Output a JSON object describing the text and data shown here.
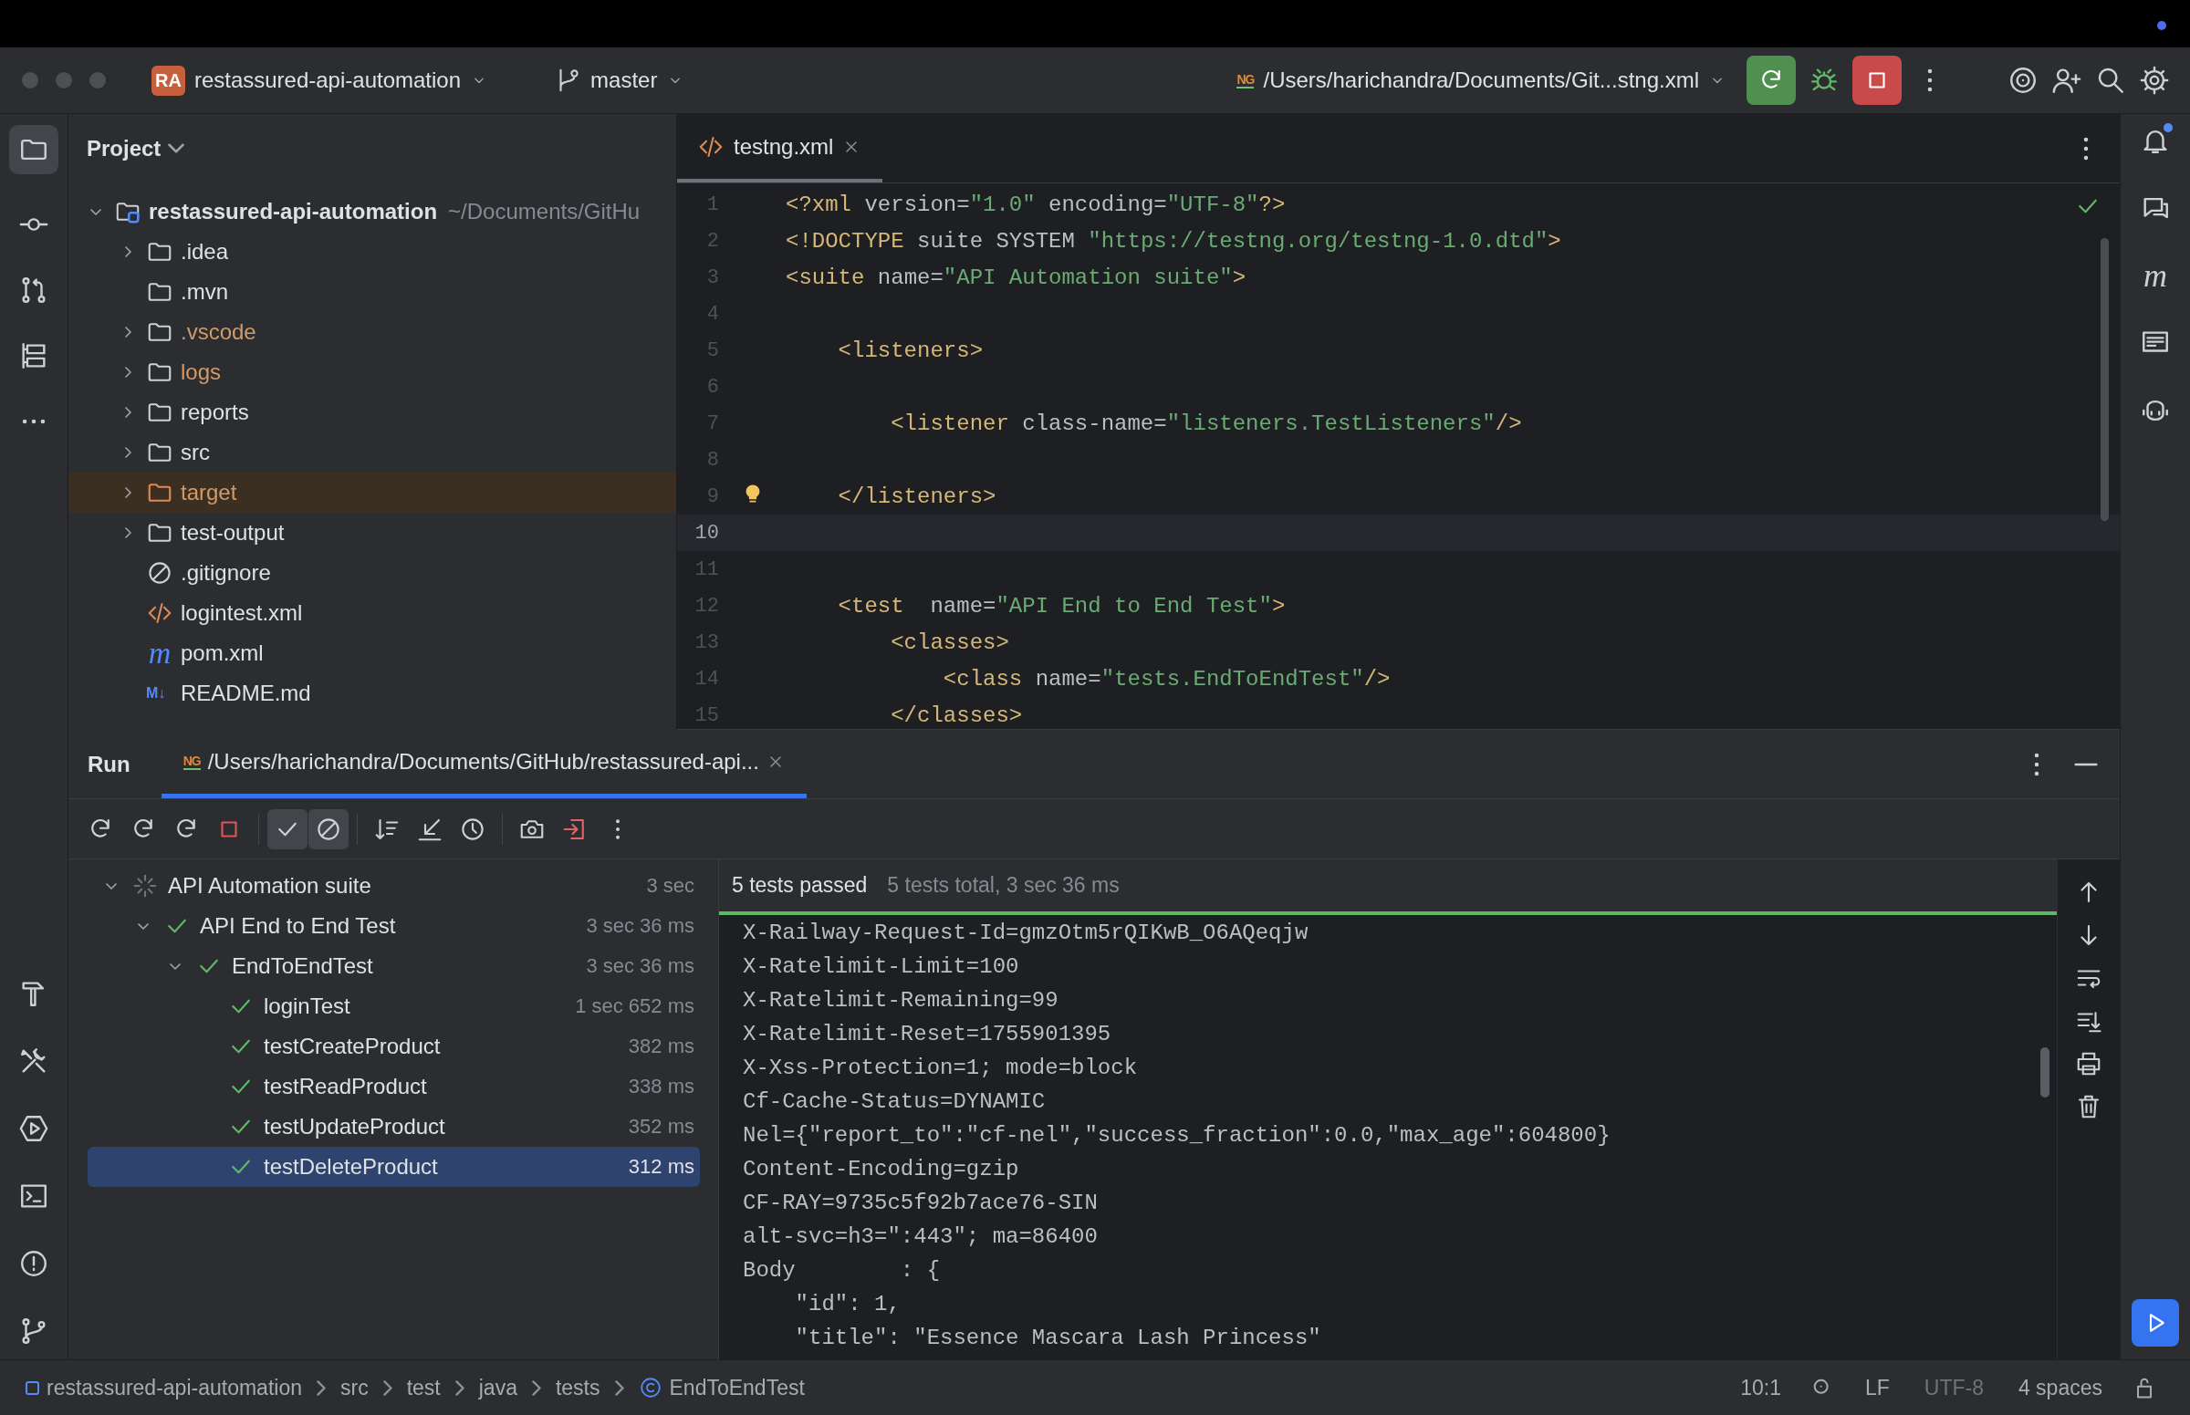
{
  "title_bar": {
    "project_badge": "RA",
    "project": "restassured-api-automation",
    "branch": "master",
    "run_config_badge": "NG",
    "run_config": "/Users/harichandra/Documents/Git...stng.xml"
  },
  "project_panel": {
    "title": "Project",
    "tree": [
      {
        "name": "restassured-api-automation",
        "path": "~/Documents/GitHu",
        "kind": "module",
        "expanded": true,
        "selected": false,
        "ignored": false,
        "children": [
          {
            "name": ".idea",
            "kind": "folder",
            "expanded": false,
            "selected": false,
            "ignored": false
          },
          {
            "name": ".mvn",
            "kind": "folder",
            "selected": false,
            "ignored": false
          },
          {
            "name": ".vscode",
            "kind": "folder",
            "expanded": false,
            "selected": false,
            "ignored": true
          },
          {
            "name": "logs",
            "kind": "folder",
            "expanded": false,
            "selected": false,
            "ignored": true
          },
          {
            "name": "reports",
            "kind": "folder",
            "expanded": false,
            "selected": false,
            "ignored": false
          },
          {
            "name": "src",
            "kind": "folder",
            "expanded": false,
            "selected": false,
            "ignored": false
          },
          {
            "name": "target",
            "kind": "excluded",
            "expanded": false,
            "selected": true,
            "ignored": true
          },
          {
            "name": "test-output",
            "kind": "folder",
            "expanded": false,
            "selected": false,
            "ignored": false
          },
          {
            "name": ".gitignore",
            "kind": "gitignore",
            "selected": false,
            "ignored": false
          },
          {
            "name": "logintest.xml",
            "kind": "xml",
            "selected": false,
            "ignored": false
          },
          {
            "name": "pom.xml",
            "kind": "maven",
            "glyph": "m",
            "selected": false,
            "ignored": false
          },
          {
            "name": "README.md",
            "kind": "markdown",
            "glyph": "M↓",
            "selected": false,
            "ignored": false
          }
        ]
      }
    ]
  },
  "editor": {
    "tabs": [
      {
        "label": "testng.xml",
        "selected": true
      }
    ],
    "inspection_ok": true,
    "right_strip_glyph": "m",
    "lines": [
      {
        "number": "1",
        "current": false,
        "bulb": false,
        "tokens": [
          {
            "kind": "tag",
            "text": "<?xml"
          },
          {
            "kind": "attr",
            "text": " version="
          },
          {
            "kind": "string",
            "text": "\"1.0\""
          },
          {
            "kind": "attr",
            "text": " encoding="
          },
          {
            "kind": "string",
            "text": "\"UTF-8\""
          },
          {
            "kind": "tag",
            "text": "?>"
          }
        ]
      },
      {
        "number": "2",
        "current": false,
        "bulb": false,
        "tokens": [
          {
            "kind": "tag",
            "text": "<!DOCTYPE"
          },
          {
            "kind": "plain",
            "text": " suite SYSTEM "
          },
          {
            "kind": "string",
            "text": "\"https://testng.org/testng-1.0.dtd\""
          },
          {
            "kind": "tag",
            "text": ">"
          }
        ]
      },
      {
        "number": "3",
        "current": false,
        "bulb": false,
        "tokens": [
          {
            "kind": "tag",
            "text": "<suite"
          },
          {
            "kind": "attr",
            "text": " name="
          },
          {
            "kind": "string",
            "text": "\"API Automation suite\""
          },
          {
            "kind": "tag",
            "text": ">"
          }
        ]
      },
      {
        "number": "4",
        "current": false,
        "bulb": false
      },
      {
        "number": "5",
        "current": false,
        "bulb": false,
        "tokens": [
          {
            "kind": "tag",
            "text": "    <listeners>"
          }
        ]
      },
      {
        "number": "6",
        "current": false,
        "bulb": false
      },
      {
        "number": "7",
        "current": false,
        "bulb": false,
        "tokens": [
          {
            "kind": "tag",
            "text": "        <listener"
          },
          {
            "kind": "attr",
            "text": " class-name="
          },
          {
            "kind": "string",
            "text": "\"listeners.TestListeners\""
          },
          {
            "kind": "tag",
            "text": "/>"
          }
        ]
      },
      {
        "number": "8",
        "current": false,
        "bulb": false
      },
      {
        "number": "9",
        "current": false,
        "bulb": true,
        "tokens": [
          {
            "kind": "tag",
            "text": "    </listeners>"
          }
        ]
      },
      {
        "number": "10",
        "current": true,
        "bulb": false
      },
      {
        "number": "11",
        "current": false,
        "bulb": false
      },
      {
        "number": "12",
        "current": false,
        "bulb": false,
        "tokens": [
          {
            "kind": "tag",
            "text": "    <test"
          },
          {
            "kind": "attr",
            "text": "  name="
          },
          {
            "kind": "string",
            "text": "\"API End to End Test\""
          },
          {
            "kind": "tag",
            "text": ">"
          }
        ]
      },
      {
        "number": "13",
        "current": false,
        "bulb": false,
        "tokens": [
          {
            "kind": "tag",
            "text": "        <classes>"
          }
        ]
      },
      {
        "number": "14",
        "current": false,
        "bulb": false,
        "tokens": [
          {
            "kind": "tag",
            "text": "            <class"
          },
          {
            "kind": "attr",
            "text": " name="
          },
          {
            "kind": "string",
            "text": "\"tests.EndToEndTest\""
          },
          {
            "kind": "tag",
            "text": "/>"
          }
        ]
      },
      {
        "number": "15",
        "current": false,
        "bulb": false,
        "tokens": [
          {
            "kind": "tag",
            "text": "        </classes>"
          }
        ]
      }
    ]
  },
  "run_panel": {
    "title": "Run",
    "tabs": [
      {
        "badge": "NG",
        "label": "/Users/harichandra/Documents/GitHub/restassured-api...",
        "selected": true
      }
    ],
    "filters": {
      "show_passed": true,
      "show_ignored": true
    },
    "tests": [
      {
        "name": "API Automation suite",
        "duration": "3 sec",
        "kind": "suite",
        "expanded": true,
        "selected": false,
        "children": [
          {
            "name": "API End to End Test",
            "duration": "3 sec 36 ms",
            "kind": "passed",
            "expanded": true,
            "selected": false,
            "children": [
              {
                "name": "EndToEndTest",
                "duration": "3 sec 36 ms",
                "kind": "passed",
                "expanded": true,
                "selected": false,
                "children": [
                  {
                    "name": "loginTest",
                    "duration": "1 sec 652 ms",
                    "kind": "passed",
                    "selected": false
                  },
                  {
                    "name": "testCreateProduct",
                    "duration": "382 ms",
                    "kind": "passed",
                    "selected": false
                  },
                  {
                    "name": "testReadProduct",
                    "duration": "338 ms",
                    "kind": "passed",
                    "selected": false
                  },
                  {
                    "name": "testUpdateProduct",
                    "duration": "352 ms",
                    "kind": "passed",
                    "selected": false
                  },
                  {
                    "name": "testDeleteProduct",
                    "duration": "312 ms",
                    "kind": "passed",
                    "selected": true
                  }
                ]
              }
            ]
          }
        ]
      }
    ],
    "summary": {
      "passed": "5 tests passed",
      "total": "5 tests total, 3 sec 36 ms",
      "level": 1
    },
    "console": [
      "X-Railway-Request-Id=gmzOtm5rQIKwB_O6AQeqjw",
      "X-Ratelimit-Limit=100",
      "X-Ratelimit-Remaining=99",
      "X-Ratelimit-Reset=1755901395",
      "X-Xss-Protection=1; mode=block",
      "Cf-Cache-Status=DYNAMIC",
      "Nel={\"report_to\":\"cf-nel\",\"success_fraction\":0.0,\"max_age\":604800}",
      "Content-Encoding=gzip",
      "CF-RAY=9735c5f92b7ace76-SIN",
      "alt-svc=h3=\":443\"; ma=86400",
      "Body        : {",
      "    \"id\": 1,",
      "    \"title\": \"Essence Mascara Lash Princess\""
    ]
  },
  "status_bar": {
    "breadcrumbs": [
      {
        "label": "restassured-api-automation",
        "kind": "module"
      },
      {
        "label": "src",
        "kind": "folder"
      },
      {
        "label": "test",
        "kind": "folder"
      },
      {
        "label": "java",
        "kind": "folder"
      },
      {
        "label": "tests",
        "kind": "folder"
      },
      {
        "label": "EndToEndTest",
        "kind": "class"
      }
    ],
    "position": "10:1",
    "line_separator": "LF",
    "encoding": "UTF-8",
    "indent": "4 spaces"
  }
}
